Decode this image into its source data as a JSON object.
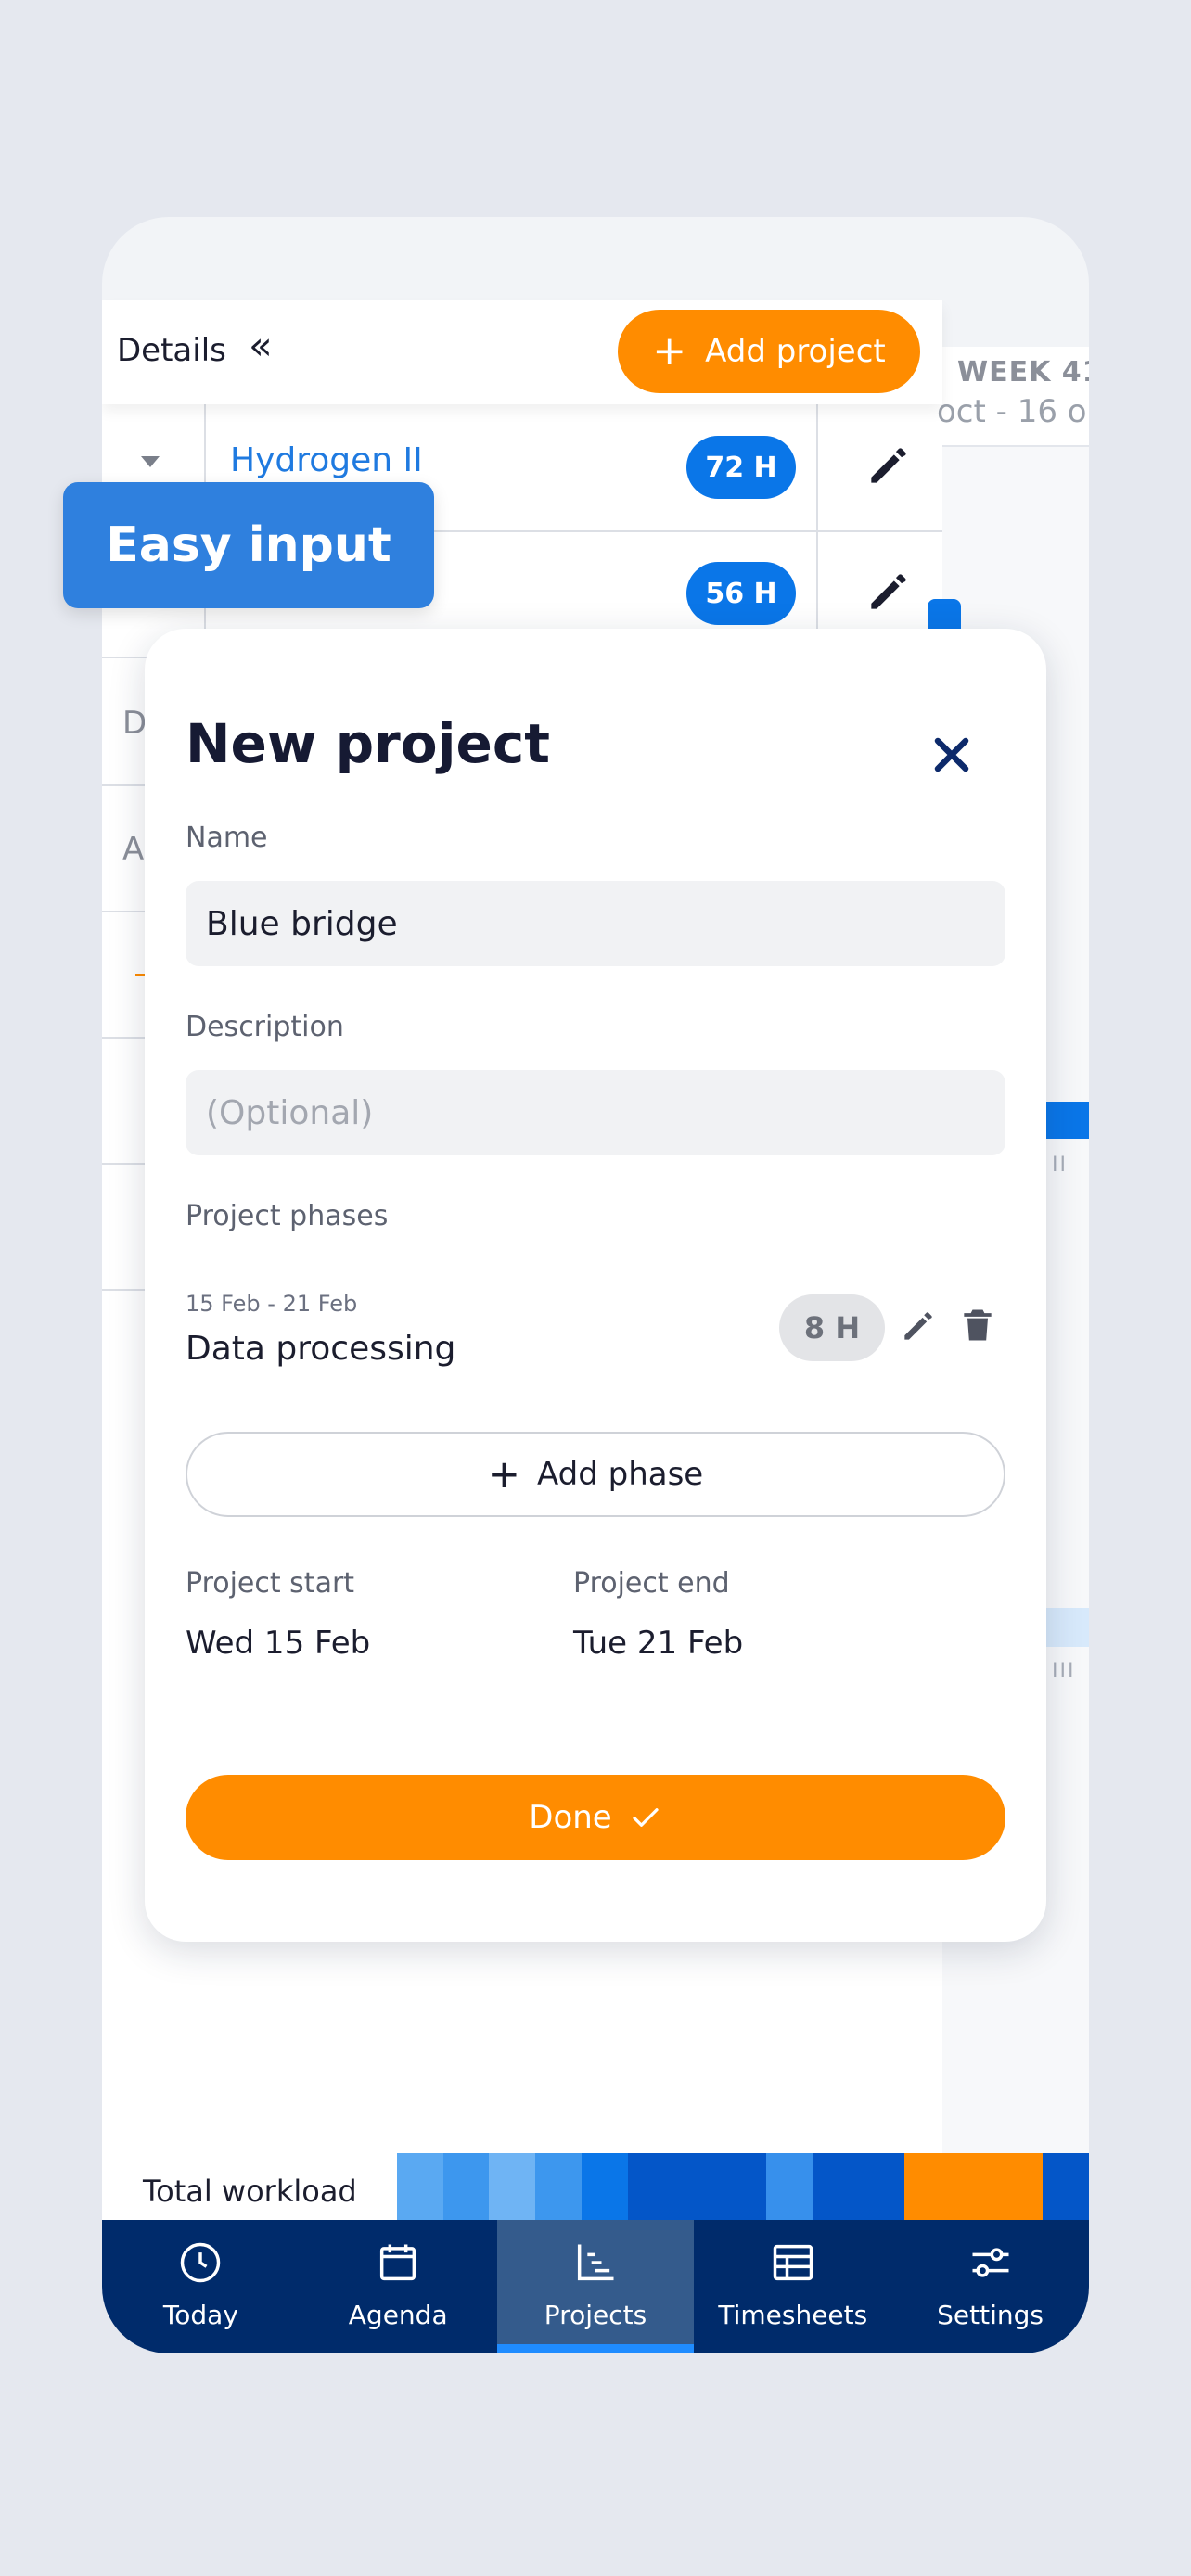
{
  "header": {
    "details_label": "Details",
    "add_project_label": "Add project",
    "week_label": "WEEK 41",
    "week_range": "oct - 16 o"
  },
  "projects": [
    {
      "name": "Hydrogen II",
      "hours": "72 H"
    },
    {
      "name": "",
      "hours": "56 H"
    }
  ],
  "ghost_rows": [
    "D",
    "A"
  ],
  "badge": {
    "label": "Easy input"
  },
  "modal": {
    "title": "New project",
    "name_label": "Name",
    "name_value": "Blue bridge",
    "description_label": "Description",
    "description_placeholder": "(Optional)",
    "phases_label": "Project phases",
    "phases": [
      {
        "dates": "15 Feb - 21 Feb",
        "name": "Data processing",
        "hours": "8 H"
      }
    ],
    "add_phase_label": "Add phase",
    "start_label": "Project start",
    "start_value": "Wed 15 Feb",
    "end_label": "Project end",
    "end_value": "Tue 21 Feb",
    "done_label": "Done"
  },
  "workload": {
    "label": "Total workload",
    "segment_colors": [
      "#5aa9f2",
      "#3d97ee",
      "#6fb4f4",
      "#3d97ee",
      "#0a76e8",
      "#0456c8",
      "#0456c8",
      "#0456c8",
      "#3790ec",
      "#0456c8",
      "#0456c8",
      "#ff8c00",
      "#ff8c00",
      "#ff8c00",
      "#0456c8"
    ]
  },
  "tabs": [
    {
      "label": "Today",
      "icon": "clock-icon"
    },
    {
      "label": "Agenda",
      "icon": "calendar-icon"
    },
    {
      "label": "Projects",
      "icon": "gantt-icon",
      "active": true
    },
    {
      "label": "Timesheets",
      "icon": "table-icon"
    },
    {
      "label": "Settings",
      "icon": "sliders-icon"
    }
  ],
  "colors": {
    "accent_orange": "#ff8c00",
    "primary_blue": "#0a76e8",
    "navy": "#002b6b",
    "badge_blue": "#2f80de"
  }
}
